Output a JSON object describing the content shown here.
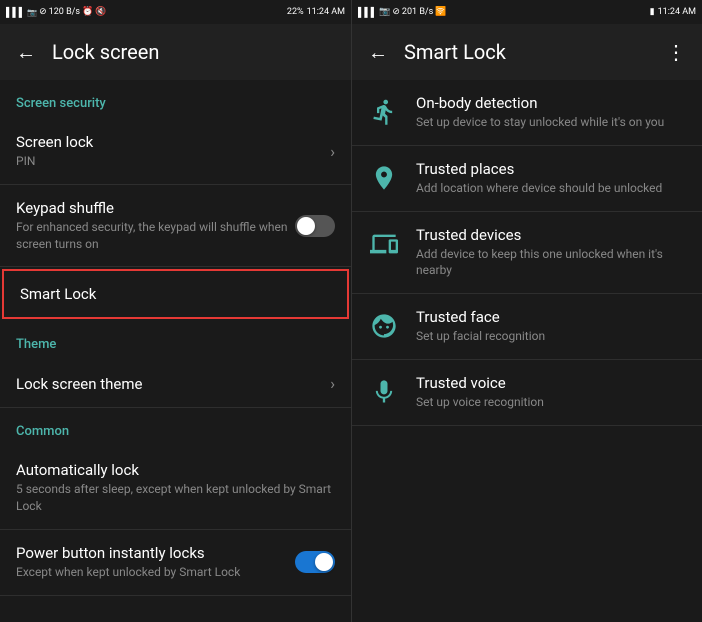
{
  "left": {
    "statusBar": {
      "signal": "📶",
      "carrier": "",
      "speed": "120 B/s",
      "icons": "⏰ 🔇",
      "battery": "22%",
      "time": "11:24 AM"
    },
    "appBar": {
      "title": "Lock screen",
      "backLabel": "←"
    },
    "sections": [
      {
        "type": "header",
        "label": "Screen security"
      },
      {
        "type": "item",
        "title": "Screen lock",
        "subtitle": "PIN",
        "hasChevron": true
      },
      {
        "type": "item",
        "title": "Keypad shuffle",
        "subtitle": "For enhanced security, the keypad will shuffle when screen turns on",
        "hasToggle": true,
        "toggleOn": false
      },
      {
        "type": "item",
        "title": "Smart Lock",
        "subtitle": "",
        "highlighted": true
      },
      {
        "type": "header",
        "label": "Theme"
      },
      {
        "type": "item",
        "title": "Lock screen theme",
        "subtitle": "",
        "hasChevron": true
      },
      {
        "type": "header",
        "label": "Common"
      },
      {
        "type": "item",
        "title": "Automatically lock",
        "subtitle": "5 seconds after sleep, except when kept unlocked by Smart Lock"
      },
      {
        "type": "item",
        "title": "Power button instantly locks",
        "subtitle": "Except when kept unlocked by Smart Lock",
        "hasToggle": true,
        "toggleOn": true
      }
    ]
  },
  "right": {
    "statusBar": {
      "speed": "201 B/s",
      "time": "11:24 AM"
    },
    "appBar": {
      "title": "Smart Lock",
      "backLabel": "←",
      "hasMore": true
    },
    "items": [
      {
        "id": "on-body",
        "title": "On-body detection",
        "subtitle": "Set up device to stay unlocked while it's on you",
        "icon": "walk"
      },
      {
        "id": "trusted-places",
        "title": "Trusted places",
        "subtitle": "Add location where device should be unlocked",
        "icon": "location"
      },
      {
        "id": "trusted-devices",
        "title": "Trusted devices",
        "subtitle": "Add device to keep this one unlocked when it's nearby",
        "icon": "devices"
      },
      {
        "id": "trusted-face",
        "title": "Trusted face",
        "subtitle": "Set up facial recognition",
        "icon": "face"
      },
      {
        "id": "trusted-voice",
        "title": "Trusted voice",
        "subtitle": "Set up voice recognition",
        "icon": "mic"
      }
    ]
  }
}
